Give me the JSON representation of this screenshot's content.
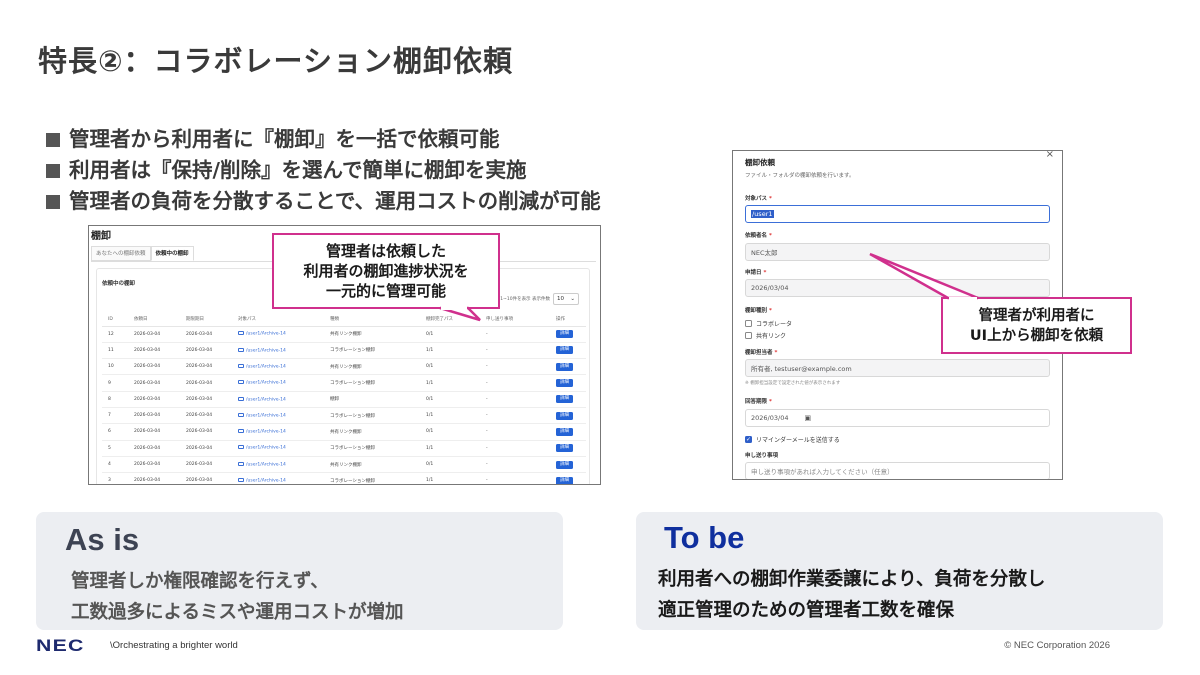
{
  "title": "特長②：コラボレーション棚卸依頼",
  "bullets": [
    "管理者から利用者に『棚卸』を一括で依頼可能",
    "利用者は『保持/削除』を選んで簡単に棚卸を実施",
    "管理者の負荷を分散することで、運用コストの削減が可能"
  ],
  "left_screen": {
    "page_title": "棚卸",
    "tabs": [
      "あなたへの棚卸依頼",
      "依頼中の棚卸"
    ],
    "card_title": "依頼中の棚卸",
    "per_page_label": "1~10件を表示  表示件数",
    "per_page_value": "10",
    "columns": [
      "ID",
      "依頼日",
      "期限期日",
      "対象パス",
      "種類",
      "棚卸完了パス",
      "申し送り事項",
      "操作"
    ],
    "rows": [
      {
        "id": "12",
        "requested": "2026-03-04",
        "due": "2026-03-04",
        "path": "/user1/Archive-14",
        "type": "共有リンク棚卸",
        "done": "0/1",
        "note": "-",
        "action": "詳細"
      },
      {
        "id": "11",
        "requested": "2026-03-04",
        "due": "2026-03-04",
        "path": "/user1/Archive-14",
        "type": "コラボレーション棚卸",
        "done": "1/1",
        "note": "-",
        "action": "詳細"
      },
      {
        "id": "10",
        "requested": "2026-03-04",
        "due": "2026-03-04",
        "path": "/user1/Archive-14",
        "type": "共有リンク棚卸",
        "done": "0/1",
        "note": "-",
        "action": "詳細"
      },
      {
        "id": "9",
        "requested": "2026-03-04",
        "due": "2026-03-04",
        "path": "/user1/Archive-14",
        "type": "コラボレーション棚卸",
        "done": "1/1",
        "note": "-",
        "action": "詳細"
      },
      {
        "id": "8",
        "requested": "2026-03-04",
        "due": "2026-03-04",
        "path": "/user1/Archive-14",
        "type": "棚卸",
        "done": "0/1",
        "note": "-",
        "action": "詳細"
      },
      {
        "id": "7",
        "requested": "2026-03-04",
        "due": "2026-03-04",
        "path": "/user1/Archive-14",
        "type": "コラボレーション棚卸",
        "done": "1/1",
        "note": "-",
        "action": "詳細"
      },
      {
        "id": "6",
        "requested": "2026-03-04",
        "due": "2026-03-04",
        "path": "/user1/Archive-14",
        "type": "共有リンク棚卸",
        "done": "0/1",
        "note": "-",
        "action": "詳細"
      },
      {
        "id": "5",
        "requested": "2026-03-04",
        "due": "2026-03-04",
        "path": "/user1/Archive-14",
        "type": "コラボレーション棚卸",
        "done": "1/1",
        "note": "-",
        "action": "詳細"
      },
      {
        "id": "4",
        "requested": "2026-03-04",
        "due": "2026-03-04",
        "path": "/user1/Archive-14",
        "type": "共有リンク棚卸",
        "done": "0/1",
        "note": "-",
        "action": "詳細"
      },
      {
        "id": "3",
        "requested": "2026-03-04",
        "due": "2026-03-04",
        "path": "/user1/Archive-14",
        "type": "コラボレーション棚卸",
        "done": "1/1",
        "note": "-",
        "action": "詳細"
      }
    ]
  },
  "callout_left": [
    "管理者は依頼した",
    "利用者の棚卸進捗状況を",
    "一元的に管理可能"
  ],
  "right_screen": {
    "close": "×",
    "title": "棚卸依頼",
    "subtitle": "ファイル・フォルダの棚卸依頼を行います。",
    "target_path_label": "対象パス",
    "target_path_value": "/user1",
    "requester_label": "依頼者名",
    "requester_value": "NEC太郎",
    "request_date_label": "申請日",
    "request_date_value": "2026/03/04",
    "kind_label": "棚卸種別",
    "kind_options": [
      "コラボレータ",
      "共有リンク"
    ],
    "assignee_label": "棚卸担当者",
    "assignee_value": "所有者, testuser@example.com",
    "assignee_hint": "※ 棚卸担当設定で設定された値が表示されます",
    "deadline_label": "回答期限",
    "deadline_value": "2026/03/04",
    "reminder_label": "リマインダーメールを送信する",
    "notes_label": "申し送り事項",
    "notes_placeholder": "申し送り事項があれば入力してください（任意）",
    "required_mark": "*"
  },
  "callout_right": [
    "管理者が利用者に",
    "UI上から棚卸を依頼"
  ],
  "as_is": {
    "heading": "As is",
    "lines": [
      "管理者しか権限確認を行えず、",
      "工数過多によるミスや運用コストが増加"
    ]
  },
  "to_be": {
    "heading": "To be",
    "lines": [
      "利用者への棚卸作業委譲により、負荷を分散し",
      "適正管理のための管理者工数を確保"
    ]
  },
  "footer": {
    "logo": "NEC",
    "tagline": "\\Orchestrating a brighter world",
    "copyright": "© NEC Corporation 2026"
  },
  "colors": {
    "callout_border": "#d0308d",
    "to_be_heading": "#0f2f9e",
    "panel_bg": "#eceef2",
    "button_blue": "#2463d6"
  }
}
